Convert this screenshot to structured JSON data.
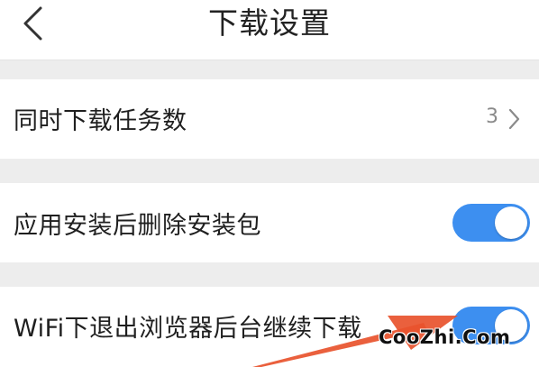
{
  "header": {
    "title": "下载设置",
    "back_icon": "chevron-left-icon"
  },
  "settings": {
    "concurrent_downloads": {
      "label": "同时下载任务数",
      "value": "3",
      "chevron_icon": "chevron-right-icon"
    },
    "delete_after_install": {
      "label": "应用安装后删除安装包",
      "enabled": true
    },
    "wifi_background_download": {
      "label": "WiFi下退出浏览器后台继续下载",
      "enabled": true
    }
  },
  "watermark": {
    "text": "CooZhi.Com"
  },
  "colors": {
    "accent": "#3d8ff0",
    "annotation_arrow": "#e8522c",
    "background": "#ededed"
  }
}
